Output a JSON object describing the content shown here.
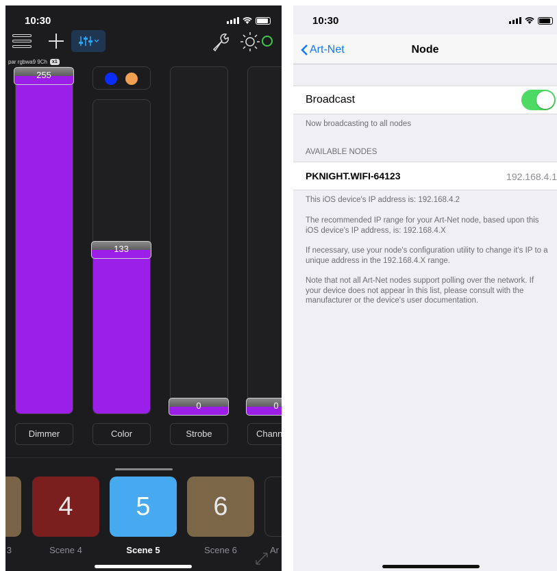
{
  "left": {
    "status_time": "10:30",
    "fixture": {
      "name": "par rgbwa9 9Ch",
      "badge": "x1"
    },
    "channels": [
      {
        "label": "Dimmer",
        "value": "255",
        "level": 1.0
      },
      {
        "label": "Color",
        "value": "133",
        "level": 0.522
      },
      {
        "label": "Strobe",
        "value": "0",
        "level": 0
      },
      {
        "label": "Chann",
        "value": "0",
        "level": 0
      }
    ],
    "color_dots": [
      "#0a2cff",
      "#f0a050"
    ],
    "scenes": [
      {
        "number": "",
        "name": "3",
        "color": "#7a6448"
      },
      {
        "number": "4",
        "name": "Scene 4",
        "color": "#7a1e1e"
      },
      {
        "number": "5",
        "name": "Scene 5",
        "color": "#47a9f0",
        "active": true
      },
      {
        "number": "6",
        "name": "Scene 6",
        "color": "#7b6747"
      },
      {
        "number": "",
        "name": "Ar",
        "color": "#1c1c1e"
      }
    ],
    "accent_color": "#9b1fe8",
    "status_online_color": "#3ec94a"
  },
  "right": {
    "status_time": "10:30",
    "nav": {
      "back_label": "Art-Net",
      "title": "Node"
    },
    "broadcast": {
      "label": "Broadcast",
      "enabled": true,
      "footer": "Now broadcasting to all nodes"
    },
    "available_header": "AVAILABLE NODES",
    "node": {
      "name": "PKNIGHT.WIFI-64123",
      "ip": "192.168.4.1"
    },
    "info": [
      "This iOS device's IP address is: 192.168.4.2",
      "The recommended IP range for your Art-Net node, based upon this iOS device's IP address, is: 192.168.4.X",
      "If necessary, use your node's configuration utility to change it's IP to a unique address in the 192.168.4.X range.",
      "Note that not all Art-Net nodes support polling over the network. If your device does not appear in this list, please consult with the manufacturer or the device's user documentation."
    ],
    "toggle_color": "#4cd964",
    "link_color": "#0a7aff"
  }
}
